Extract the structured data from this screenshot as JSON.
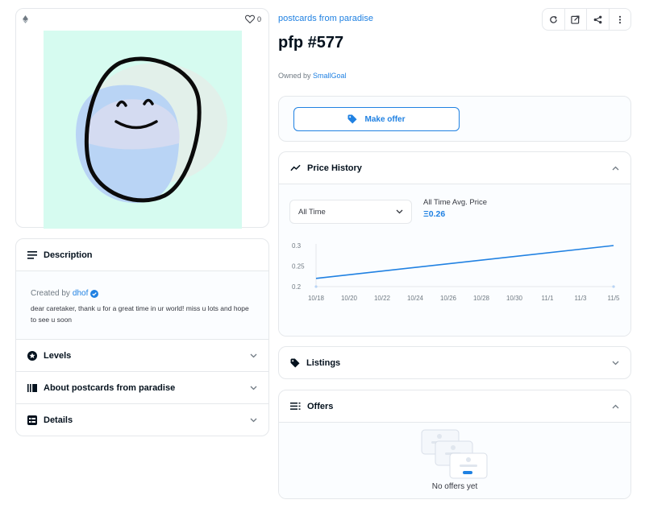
{
  "image_panel": {
    "favorite_count": "0"
  },
  "description": {
    "title": "Description",
    "created_prefix": "Created by",
    "creator": "dhof",
    "text": "dear caretaker, thank u for a great time in ur world! miss u lots and hope to see u soon"
  },
  "accordions": [
    {
      "label": "Levels",
      "icon": "star-circle-icon"
    },
    {
      "label": "About postcards from paradise",
      "icon": "vertical-bars-icon"
    },
    {
      "label": "Details",
      "icon": "details-list-icon"
    }
  ],
  "header": {
    "collection": "postcards from paradise",
    "title": "pfp #577",
    "owned_prefix": "Owned by",
    "owner": "SmallGoal"
  },
  "actions": [
    "refresh-icon",
    "external-link-icon",
    "share-icon",
    "more-icon"
  ],
  "make_offer_label": "Make offer",
  "price_history": {
    "title": "Price History",
    "range_selected": "All Time",
    "avg_label": "All Time Avg. Price",
    "avg_value": "Ξ0.26"
  },
  "listings": {
    "title": "Listings"
  },
  "offers": {
    "title": "Offers",
    "empty_text": "No offers yet"
  },
  "colors": {
    "accent": "#2081e2",
    "border": "#e5e8eb",
    "image_bg": "#d6fbf0"
  },
  "chart_data": {
    "type": "line",
    "title": "",
    "xlabel": "",
    "ylabel": "",
    "x_ticks": [
      "10/18",
      "10/20",
      "10/22",
      "10/24",
      "10/26",
      "10/28",
      "10/30",
      "11/1",
      "11/3",
      "11/5"
    ],
    "y_ticks": [
      0.2,
      0.25,
      0.3
    ],
    "ylim": [
      0.2,
      0.3
    ],
    "series": [
      {
        "x": [
          "10/18",
          "11/5"
        ],
        "values": [
          0.22,
          0.3
        ]
      }
    ],
    "grid": false
  }
}
